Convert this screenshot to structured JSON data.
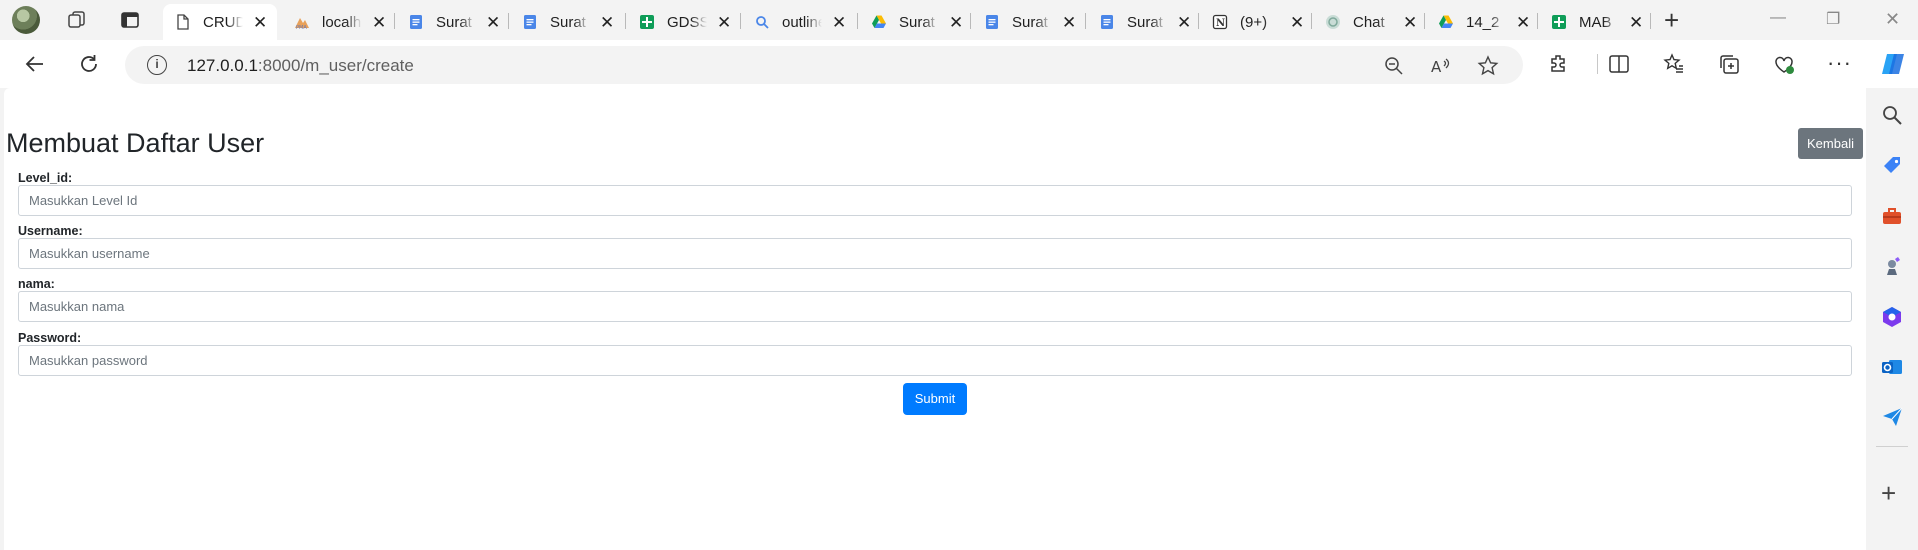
{
  "browser": {
    "tabs": [
      {
        "title": "CRUD",
        "icon": "page-icon",
        "active": true
      },
      {
        "title": "localhost",
        "icon": "phpmyadmin-icon"
      },
      {
        "title": "Surat",
        "icon": "docs-icon"
      },
      {
        "title": "Surat",
        "icon": "docs-icon"
      },
      {
        "title": "GDSS",
        "icon": "sheets-icon"
      },
      {
        "title": "outline",
        "icon": "search-icon"
      },
      {
        "title": "Surat",
        "icon": "drive-icon"
      },
      {
        "title": "Surat",
        "icon": "docs-icon"
      },
      {
        "title": "Surat",
        "icon": "docs-icon"
      },
      {
        "title": "(9+)",
        "icon": "notion-icon"
      },
      {
        "title": "Chat",
        "icon": "chatgpt-icon"
      },
      {
        "title": "14_2",
        "icon": "drive-icon"
      },
      {
        "title": "MAB",
        "icon": "sheets-icon"
      }
    ],
    "url_host": "127.0.0.1",
    "url_path": ":8000/m_user/create"
  },
  "page": {
    "title": "Membuat Daftar User",
    "back_label": "Kembali",
    "fields": [
      {
        "label": "Level_id:",
        "placeholder": "Masukkan Level Id"
      },
      {
        "label": "Username:",
        "placeholder": "Masukkan username"
      },
      {
        "label": "nama:",
        "placeholder": "Masukkan nama"
      },
      {
        "label": "Password:",
        "placeholder": "Masukkan password"
      }
    ],
    "submit_label": "Submit"
  },
  "colors": {
    "back_button": "#6c757d",
    "submit_button": "#007bff"
  }
}
